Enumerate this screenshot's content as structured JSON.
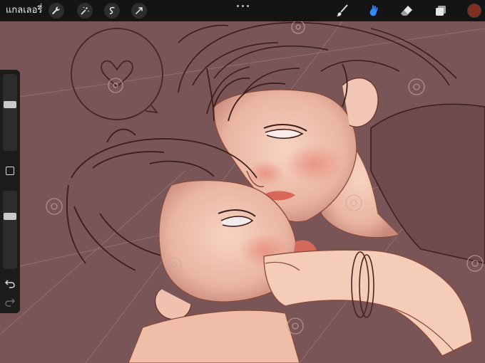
{
  "toolbar": {
    "gallery_label": "แกลเลอรี่",
    "left_tools": [
      {
        "icon": "wrench-icon",
        "name": "actions"
      },
      {
        "icon": "magic-wand-icon",
        "name": "adjustments"
      },
      {
        "icon": "selection-icon",
        "name": "selection"
      },
      {
        "icon": "transform-arrow-icon",
        "name": "transform"
      }
    ],
    "right_tools": [
      {
        "icon": "brush-icon",
        "name": "paint"
      },
      {
        "icon": "smudge-icon",
        "name": "smudge",
        "active": true
      },
      {
        "icon": "eraser-icon",
        "name": "erase"
      },
      {
        "icon": "layers-icon",
        "name": "layers"
      }
    ],
    "active_color": "#7e2f22",
    "accent_color": "#2f8cff"
  },
  "sidebar": {
    "brush_size_level": 0.62,
    "opacity_level": 0.7
  },
  "canvas": {
    "background_color": "#7a5557",
    "line_color": "#7a3a2c",
    "skin_color": "#f1c3b0"
  }
}
